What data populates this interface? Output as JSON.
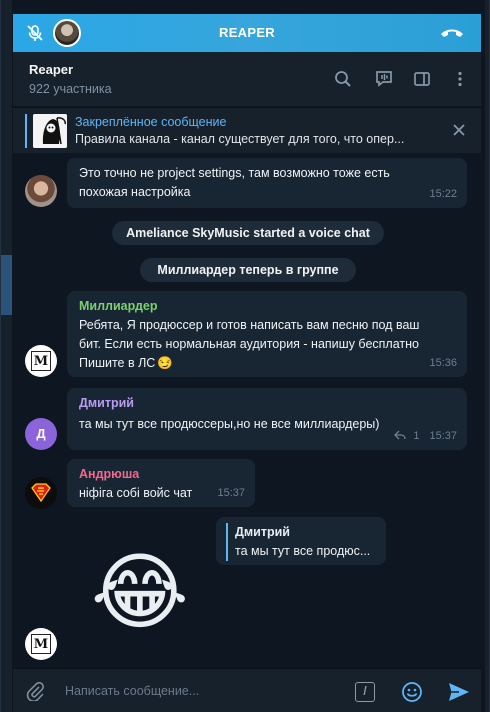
{
  "voice_chat": {
    "title": "REAPER"
  },
  "header": {
    "name": "Reaper",
    "members": "922 участника"
  },
  "pinned": {
    "title": "Закреплённое сообщение",
    "text": "Правила канала  - канал существует для того, что опер..."
  },
  "messages": [
    {
      "text_line1": "Это точно не project settings, там возможно тоже есть",
      "text_line2": "похожая настройка",
      "time": "15:22"
    },
    {
      "service": "Ameliance SkyMusic started a voice chat"
    },
    {
      "service": "Миллиардер теперь в группе"
    },
    {
      "author": "Миллиардер",
      "author_color": "#7cd06f",
      "line1": "Ребята, Я продюссер и готов написать вам песню под ваш",
      "line2": "бит. Если есть нормальная аудитория - напишу бесплатно",
      "line3": "Пишите в ЛС",
      "emoji": "😏",
      "time": "15:36",
      "avatar_letter": "M"
    },
    {
      "author": "Дмитрий",
      "author_color": "#b89cf0",
      "text": "та мы тут все продюссеры,но не все миллиардеры)",
      "replies": "1",
      "time": "15:37",
      "avatar_letter": "Д"
    },
    {
      "author": "Андрюша",
      "author_color": "#f06a8f",
      "text": "ніфіга собі войс чат",
      "time": "15:37"
    },
    {
      "reply_author": "Дмитрий",
      "reply_text": "та мы тут все продюс..."
    },
    {
      "sticker": "😂",
      "avatar_letter": "M"
    }
  ],
  "input": {
    "placeholder": "Написать сообщение...",
    "command_symbol": "/"
  },
  "colors": {
    "accent": "#5eb5f7",
    "voice_bar": "#2aa7e6",
    "background": "#0e1621",
    "panel": "#17212b",
    "bubble": "#182533"
  },
  "icons": [
    "mic-off-icon",
    "hangup-icon",
    "search-icon",
    "voice-chat-icon",
    "sidebar-icon",
    "more-icon",
    "close-icon",
    "attach-icon",
    "command-icon",
    "emoji-icon",
    "send-icon",
    "reply-arrow-icon"
  ]
}
